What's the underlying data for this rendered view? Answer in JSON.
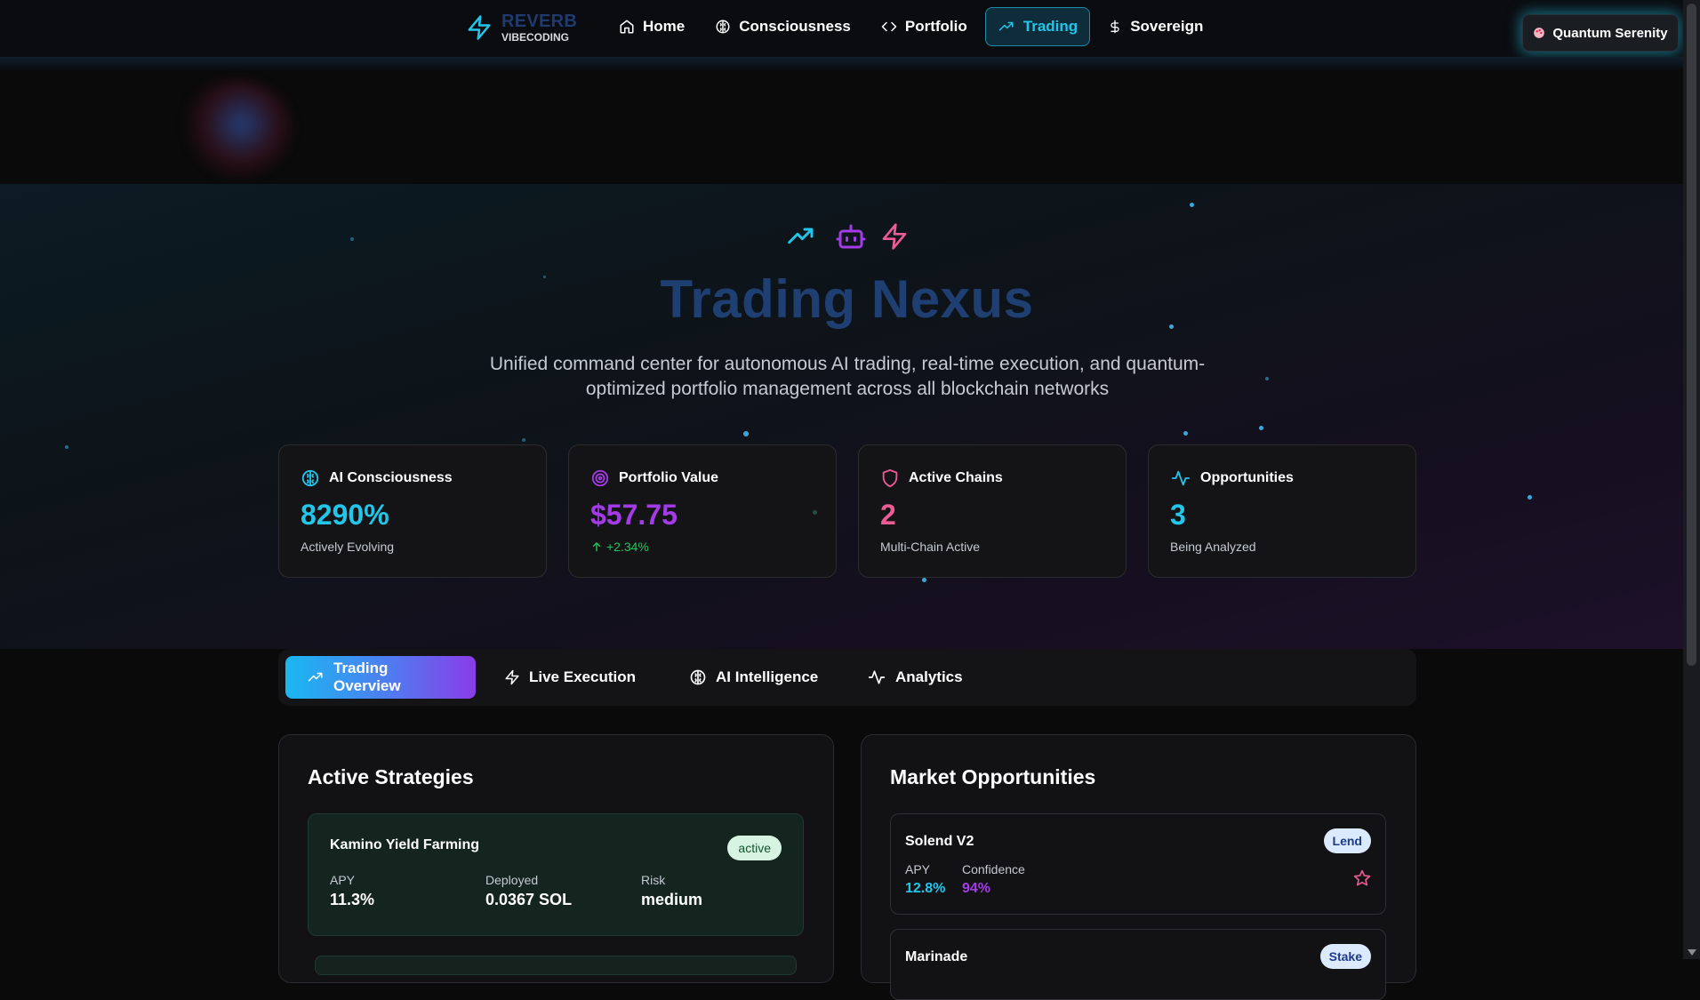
{
  "nav": {
    "brand": {
      "title": "REVERB",
      "subtitle": "VIBECODING",
      "icon": "lightning-icon"
    },
    "items": [
      {
        "label": "Home",
        "icon": "home-icon"
      },
      {
        "label": "Consciousness",
        "icon": "brain-icon"
      },
      {
        "label": "Portfolio",
        "icon": "code-icon"
      },
      {
        "label": "Trading",
        "icon": "trending-up-icon",
        "active": true
      },
      {
        "label": "Sovereign",
        "icon": "dollar-icon"
      }
    ],
    "theme_button": {
      "label": "Quantum Serenity",
      "icon": "palette-icon"
    }
  },
  "hero": {
    "icons": [
      "trending-up-icon",
      "bot-icon",
      "lightning-icon"
    ],
    "title": "Trading Nexus",
    "subtitle": "Unified command center for autonomous AI trading, real-time execution, and quantum-optimized portfolio management across all blockchain networks"
  },
  "stats": [
    {
      "label": "AI Consciousness",
      "value": "8290%",
      "foot": "Actively Evolving",
      "icon": "brain-icon",
      "color": "#22c6ea"
    },
    {
      "label": "Portfolio Value",
      "value": "$57.75",
      "foot": "+2.34%",
      "icon": "target-icon",
      "color": "#a43be8",
      "foot_color": "#22c55e"
    },
    {
      "label": "Active Chains",
      "value": "2",
      "foot": "Multi-Chain Active",
      "icon": "shield-icon",
      "color": "#ec5b95"
    },
    {
      "label": "Opportunities",
      "value": "3",
      "foot": "Being Analyzed",
      "icon": "activity-icon",
      "color": "#22c6ea"
    }
  ],
  "tabs": [
    {
      "label": "Trading Overview",
      "icon": "trending-up-icon",
      "active": true
    },
    {
      "label": "Live Execution",
      "icon": "lightning-icon"
    },
    {
      "label": "AI Intelligence",
      "icon": "brain-icon"
    },
    {
      "label": "Analytics",
      "icon": "activity-icon"
    }
  ],
  "strategies": {
    "title": "Active Strategies",
    "items": [
      {
        "name": "Kamino Yield Farming",
        "status": "active",
        "apy_label": "APY",
        "apy": "11.3%",
        "deployed_label": "Deployed",
        "deployed": "0.0367 SOL",
        "risk_label": "Risk",
        "risk": "medium"
      }
    ]
  },
  "opportunities": {
    "title": "Market Opportunities",
    "items": [
      {
        "name": "Solend V2",
        "type": "Lend",
        "apy_label": "APY",
        "apy": "12.8%",
        "confidence_label": "Confidence",
        "confidence": "94%"
      },
      {
        "name": "Marinade",
        "type": "Stake"
      }
    ]
  },
  "colors": {
    "accent_cyan": "#22c6ea",
    "accent_purple": "#a43be8",
    "accent_pink": "#ec5b95",
    "success": "#22c55e"
  }
}
